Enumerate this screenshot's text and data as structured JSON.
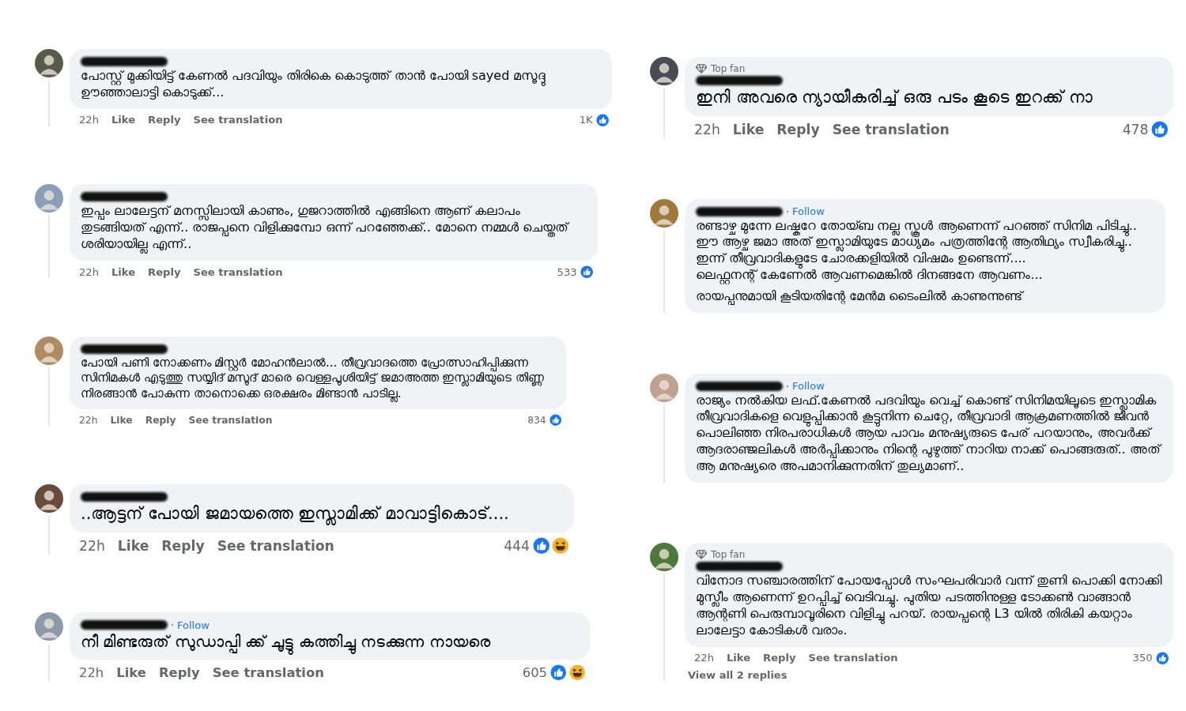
{
  "columns": [
    {
      "comments": [
        {
          "paragraphs": [
            "പോസ്റ്റ് മുക്കിയിട്ട് കേണൽ പദവിയും തിരികെ കൊടുത്ത് താൻ പോയി sayed മസൂദ്ദു ഊഞ്ഞാലാട്ടി കൊടുക്ക്..."
          ],
          "actions": {
            "time": "22h",
            "like": "Like",
            "reply": "Reply",
            "translate": "See translation",
            "count": "1K",
            "reactions": [
              {
                "kind": "like"
              }
            ]
          }
        },
        {
          "paragraphs": [
            "ഇപ്പം ലാലേട്ടന് മനസ്സിലായി കാണും, ഗുജറാത്തിൽ എങ്ങിനെ ആണ് കലാപം തുടങ്ങിയത് എന്ന്.. രാജപ്പനെ വിളിക്കുമ്പോ ഒന്ന് പറഞ്ഞേക്ക്.. മോനെ നമ്മൾ ചെയ്തത് ശരിയായില്ല എന്ന്.."
          ],
          "actions": {
            "time": "22h",
            "like": "Like",
            "reply": "Reply",
            "translate": "See translation",
            "count": "533",
            "reactions": [
              {
                "kind": "like"
              }
            ]
          }
        },
        {
          "paragraphs": [
            "പോയി പണി നോക്കണം മിസ്റ്റർ മോഹൻലാൽ... തീവ്രവാദത്തെ പ്രോത്സാഹിപ്പിക്കുന്ന സിനിമകൾ എടുത്തു സയ്യിദ് മസൂദ് മാരെ വെള്ളപൂശിയിട്ട് ജമാഅത്ത ഇസ്ലാമിയുടെ തിണ്ണ നിരങ്ങാൻ പോകുന്ന താനൊക്കെ ഒരക്ഷരം മിണ്ടാൻ പാടില്ല."
          ],
          "actions": {
            "time": "22h",
            "like": "Like",
            "reply": "Reply",
            "translate": "See translation",
            "count": "834",
            "reactions": [
              {
                "kind": "like"
              }
            ]
          }
        },
        {
          "paragraphs": [
            "..ആട്ടന് പോയി ജമായത്തെ ഇസ്ലാമിക്ക് മാവാട്ടികൊട്...."
          ],
          "actions": {
            "time": "22h",
            "like": "Like",
            "reply": "Reply",
            "translate": "See translation",
            "count": "444",
            "reactions": [
              {
                "kind": "like"
              },
              {
                "kind": "haha"
              }
            ]
          }
        },
        {
          "follow": "Follow",
          "paragraphs": [
            "നീ മിണ്ടരുത് സുഡാപ്പി ക്ക് ചൂട്ടു കത്തിച്ചു നടക്കുന്ന നായരെ"
          ],
          "actions": {
            "time": "22h",
            "like": "Like",
            "reply": "Reply",
            "translate": "See translation",
            "count": "605",
            "reactions": [
              {
                "kind": "like"
              },
              {
                "kind": "haha"
              }
            ]
          }
        }
      ]
    },
    {
      "comments": [
        {
          "badge": "Top fan",
          "paragraphs": [
            "ഇനി അവരെ ന്യായീകരിച്ച് ഒരു പടം കൂടെ ഇറക്ക് നാ"
          ],
          "actions": {
            "time": "22h",
            "like": "Like",
            "reply": "Reply",
            "translate": "See translation",
            "count": "478",
            "reactions": [
              {
                "kind": "like"
              }
            ]
          }
        },
        {
          "follow": "Follow",
          "paragraphs": [
            "രണ്ടാഴ്ച മുന്നേ ലഷ്കറേ തോയ്ബ നല്ല സ്കൂൾ ആണെന്ന് പറഞ്ഞ് സിനിമ പിടിച്ചു..\nഈ ആഴ്ച ജമാ അത് ഇസ്ലാമിയുടേ മാധ്യമം പത്രത്തിന്റേ ആതിഥ്യം സ്വീകരിച്ചു..\nഇന്ന് തീവ്രവാദികളുടേ ചോരക്കളിയിൽ വിഷമം ഉണ്ടെന്ന്....\nലെഫ്റ്റനന്റ് കേണേൽ ആവണമെങ്കിൽ ദിനങ്ങനേ ആവണം...",
            "രായപ്പനുമായി കൂടിയതിന്റേ മേൻമ ടൈംലിൽ കാണുന്നുണ്ട്"
          ]
        },
        {
          "follow": "Follow",
          "paragraphs": [
            "രാജ്യം നൽകിയ ലഫ്.കേണൽ പദവിയും വെച്ച് കൊണ്ട് സിനിമയിലൂടെ ഇസ്ലാമിക തീവ്രവാദികളെ വെളുപ്പിക്കാൻ കൂട്ടുനിന്ന ചെറ്റേ, തീവ്രവാദി ആക്രമണത്തിൽ ജീവൻ പൊലിഞ്ഞ നിരപരാധികൾ ആയ പാവം മനുഷ്യരുടെ പേര് പറയാനും, അവർക്ക് ആദരാഞ്ജലികൾ അർപ്പിക്കാനും നിന്റെ പുഴുത്ത് നാറിയ നാക്ക് പൊങ്ങരുത്.. അത് ആ മനുഷ്യരെ അപമാനിക്കുന്നതിന് തുല്യമാണ്.."
          ]
        },
        {
          "badge": "Top fan",
          "paragraphs": [
            "വിനോദ സഞ്ചാരത്തിന് പോയപ്പോൾ സംഘപരിവാർ വന്ന് തുണി പൊക്കി നോക്കി മുസ്ലീം ആണെന്ന് ഉറപ്പിച്ച് വെടിവച്ചു. പുതിയ പടത്തിനുള്ള ടോക്കൺ വാങ്ങാൻ ആന്റണി പെരുമ്പാവൂരിനെ വിളിച്ചു പറയ്. രായപ്പന്റെ L3 യിൽ തിരികി കയറ്റാം ലാലേട്ടാ കോടികൾ വരാം."
          ],
          "actions": {
            "time": "22h",
            "like": "Like",
            "reply": "Reply",
            "translate": "See translation",
            "count": "350",
            "reactions": [
              {
                "kind": "like"
              }
            ]
          },
          "replies": "View all 2 replies"
        }
      ]
    }
  ]
}
